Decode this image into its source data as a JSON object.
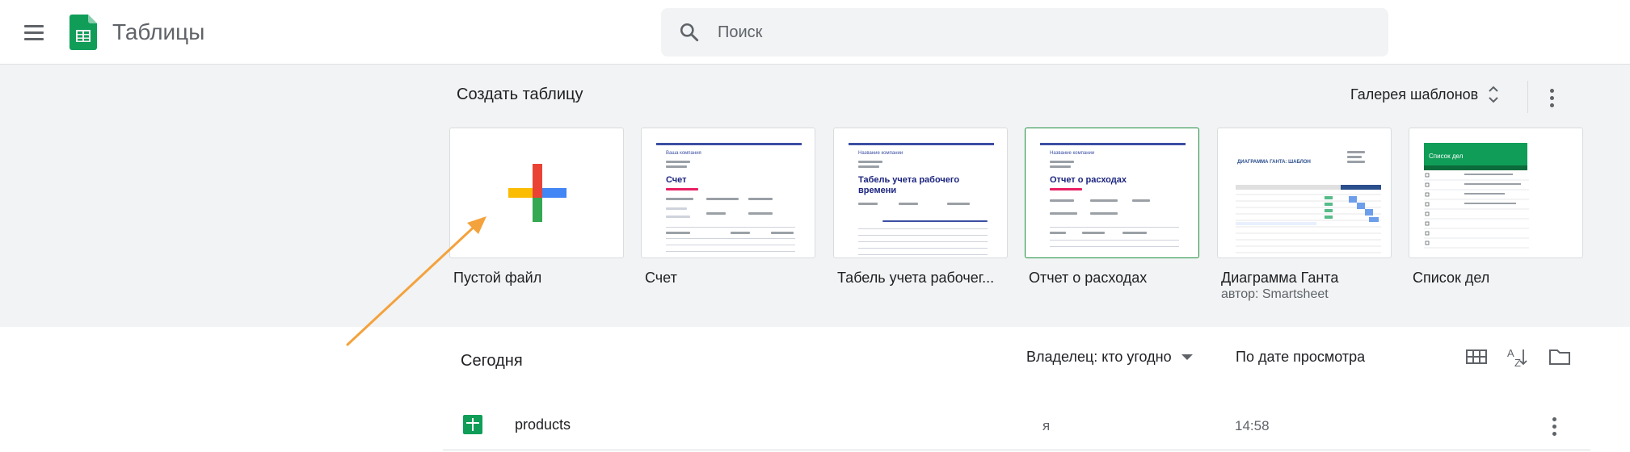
{
  "header": {
    "app_title": "Таблицы",
    "search_placeholder": "Поиск"
  },
  "templates_section": {
    "title": "Создать таблицу",
    "gallery_label": "Галерея шаблонов",
    "items": [
      {
        "label": "Пустой файл",
        "subtitle": ""
      },
      {
        "label": "Счет",
        "subtitle": ""
      },
      {
        "label": "Табель учета рабочег...",
        "subtitle": ""
      },
      {
        "label": "Отчет о расходах",
        "subtitle": ""
      },
      {
        "label": "Диаграмма Ганта",
        "subtitle": "автор: Smartsheet"
      },
      {
        "label": "Список дел",
        "subtitle": ""
      }
    ],
    "thumbs": {
      "invoice": {
        "company": "Ваша компания",
        "title": "Счет"
      },
      "timesheet": {
        "company": "Название компании",
        "title": "Табель учета рабочего времени"
      },
      "expense": {
        "company": "Название компании",
        "title": "Отчет о расходах"
      },
      "gantt": {
        "title": "ДИАГРАММА ГАНТА: ШАБЛОН"
      },
      "todo": {
        "title": "Список дел"
      }
    }
  },
  "file_list": {
    "section_title": "Сегодня",
    "owner_filter": "Владелец: кто угодно",
    "sort_label": "По дате просмотра",
    "files": [
      {
        "name": "products",
        "owner": "я",
        "time": "14:58"
      }
    ]
  },
  "colors": {
    "sheets_green": "#0f9d58",
    "plus_red": "#ea4335",
    "plus_blue": "#4285f4",
    "plus_green": "#34a853",
    "plus_yellow": "#fbbc04",
    "annotation_arrow": "#f4a23c"
  }
}
